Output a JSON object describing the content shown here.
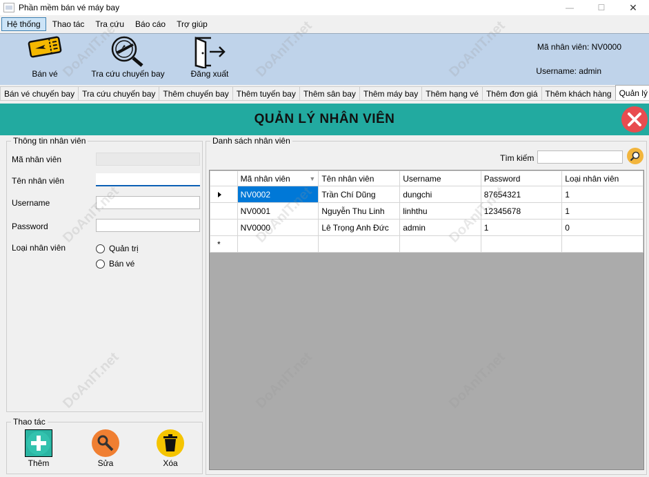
{
  "window": {
    "title": "Phần mềm bán vé máy bay",
    "minimize": "—",
    "maximize": "☐",
    "close": "✕"
  },
  "menu": [
    "Hệ thống",
    "Thao tác",
    "Tra cứu",
    "Báo cáo",
    "Trợ giúp"
  ],
  "toolbar": {
    "ban_ve": "Bán vé",
    "tra_cuu": "Tra cứu chuyến bay",
    "dang_xuat": "Đăng xuất",
    "ma_nv": "Mã nhân viên: NV0000",
    "username": "Username: admin"
  },
  "tabs": [
    "Bán vé chuyến bay",
    "Tra cứu chuyến bay",
    "Thêm chuyến bay",
    "Thêm tuyến bay",
    "Thêm sân bay",
    "Thêm máy bay",
    "Thêm hạng vé",
    "Thêm đơn giá",
    "Thêm khách hàng",
    "Quản lý nhân viên"
  ],
  "header": {
    "title": "QUẢN LÝ NHÂN VIÊN"
  },
  "info": {
    "group_title": "Thông tin nhân viên",
    "ma_nv_label": "Mã nhân viên",
    "ten_nv_label": "Tên nhân viên",
    "username_label": "Username",
    "password_label": "Password",
    "loai_label": "Loại nhân viên",
    "quan_tri": "Quản trị",
    "ban_ve": "Bán vé",
    "ma_nv_value": "",
    "ten_nv_value": "",
    "username_value": "",
    "password_value": ""
  },
  "actions": {
    "group_title": "Thao tác",
    "them": "Thêm",
    "sua": "Sửa",
    "xoa": "Xóa"
  },
  "list": {
    "group_title": "Danh sách nhân viên",
    "search_label": "Tìm kiếm",
    "search_value": "",
    "columns": [
      "Mã nhân viên",
      "Tên nhân viên",
      "Username",
      "Password",
      "Loại nhân viên"
    ],
    "rows": [
      [
        "NV0002",
        "Trần Chí Dũng",
        "dungchi",
        "87654321",
        "1"
      ],
      [
        "NV0001",
        "Nguyễn Thu Linh",
        "linhthu",
        "12345678",
        "1"
      ],
      [
        "NV0000",
        "Lê Trọng Anh Đức",
        "admin",
        "1",
        "0"
      ]
    ]
  },
  "watermark": "DoAnIT.net",
  "colors": {
    "header_band": "#22aaa0",
    "toolbar": "#bfd3ea",
    "selected_cell": "#0078d7",
    "close_red": "#e84c4f"
  }
}
